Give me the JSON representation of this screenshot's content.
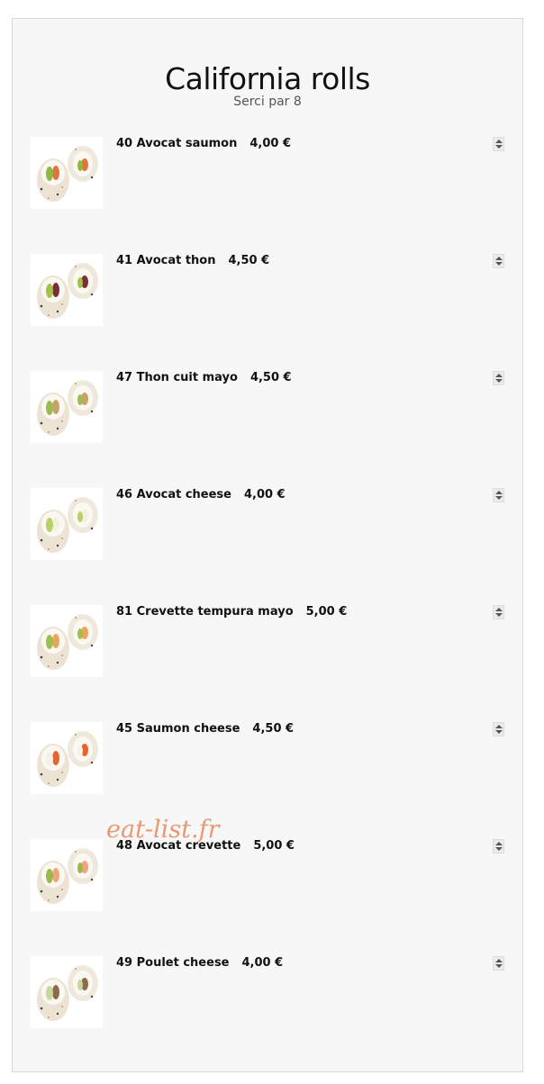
{
  "header": {
    "title": "California rolls",
    "subtitle": "Serci par 8"
  },
  "items": [
    {
      "name": "40 Avocat saumon",
      "price": "4,00 €",
      "filling": "#e2733d",
      "filling2": "#8fb842"
    },
    {
      "name": "41 Avocat thon",
      "price": "4,50 €",
      "filling": "#7a2f36",
      "filling2": "#a7c24a"
    },
    {
      "name": "47 Thon cuit mayo",
      "price": "4,50 €",
      "filling": "#caa165",
      "filling2": "#9dbb55"
    },
    {
      "name": "46 Avocat cheese",
      "price": "4,00 €",
      "filling": "#f3f0df",
      "filling2": "#b8cf6a"
    },
    {
      "name": "81 Crevette tempura mayo",
      "price": "5,00 €",
      "filling": "#f0a35a",
      "filling2": "#9fbf4f"
    },
    {
      "name": "45 Saumon cheese",
      "price": "4,50 €",
      "filling": "#e9632f",
      "filling2": "#f4f1e6"
    },
    {
      "name": "48 Avocat crevette",
      "price": "5,00 €",
      "filling": "#f1a47a",
      "filling2": "#9ab94c"
    },
    {
      "name": "49 Poulet cheese",
      "price": "4,00 €",
      "filling": "#8c6a4a",
      "filling2": "#c9d79a"
    }
  ],
  "watermark": "eat-list.fr",
  "icons": {
    "stepper": "quantity-stepper"
  }
}
